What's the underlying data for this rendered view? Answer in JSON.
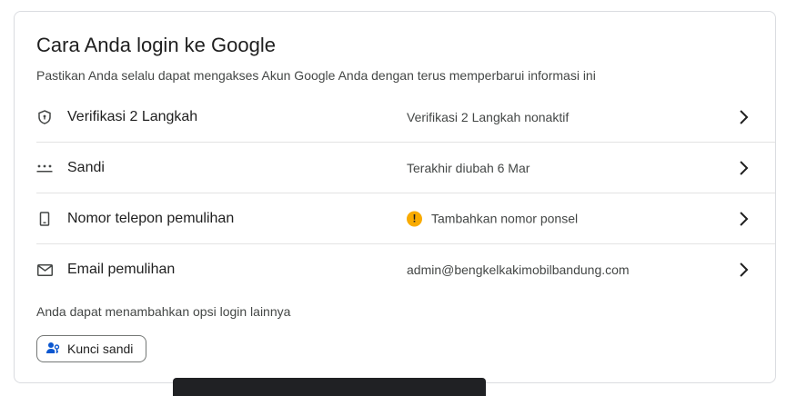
{
  "section": {
    "title": "Cara Anda login ke Google",
    "subtitle": "Pastikan Anda selalu dapat mengakses Akun Google Anda dengan terus memperbarui informasi ini"
  },
  "rows": [
    {
      "label": "Verifikasi 2 Langkah",
      "value": "Verifikasi 2 Langkah nonaktif",
      "icon": "shield-icon"
    },
    {
      "label": "Sandi",
      "value": "Terakhir diubah 6 Mar",
      "icon": "password-dots-icon"
    },
    {
      "label": "Nomor telepon pemulihan",
      "value": "Tambahkan nomor ponsel",
      "icon": "phone-icon",
      "status_icon": "warning-icon",
      "status_color": "#f9ab00"
    },
    {
      "label": "Email pemulihan",
      "value": "admin@bengkelkakimobilbandung.com",
      "icon": "mail-icon"
    }
  ],
  "more": {
    "text": "Anda dapat menambahkan opsi login lainnya",
    "passkey_button": "Kunci sandi"
  },
  "colors": {
    "accent": "#0b57d0",
    "warning": "#f9ab00",
    "border": "#dadce0"
  }
}
